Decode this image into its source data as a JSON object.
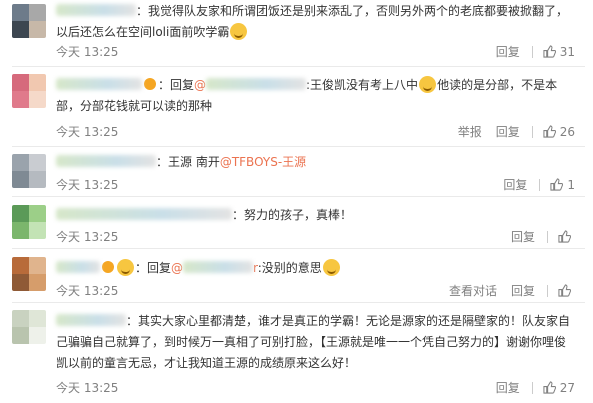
{
  "comments": [
    {
      "text": "：我觉得队友家和所谓团饭还是别来添乱了，否则另外两个的老底都要被掀翻了，以后还怎么在空间loli面前吹学霸",
      "time": "今天 13:25",
      "actions": [
        "回复"
      ],
      "likes": "31",
      "avatar_colors": [
        "#6d7b8a",
        "#a8a8a8",
        "#3c4650",
        "#c7b8a8"
      ]
    },
    {
      "prefix": "：回复",
      "reply_to": "@",
      "text": ":王俊凯没有考上八中",
      "text2": "他读的是分部，不是本部，分部花钱就可以读的那种",
      "time": "今天 13:25",
      "actions": [
        "举报",
        "回复"
      ],
      "likes": "26",
      "avatar_colors": [
        "#d66a7c",
        "#f1c8b0",
        "#e07a8b",
        "#f5d9c9"
      ]
    },
    {
      "text": "：王源 南开",
      "mention": "@TFBOYS-王源",
      "time": "今天 13:25",
      "actions": [
        "回复"
      ],
      "likes": "1",
      "avatar_colors": [
        "#9aa3ac",
        "#c9ccd1",
        "#7f8a94",
        "#b5bac0"
      ]
    },
    {
      "text": "：努力的孩子，真棒！",
      "time": "今天 13:25",
      "actions": [
        "回复"
      ],
      "likes": "",
      "avatar_colors": [
        "#5b9a58",
        "#9ccf88",
        "#7bb66c",
        "#c3e3b5"
      ]
    },
    {
      "prefix": "：回复",
      "reply_to": "@",
      "reply_suffix": "r",
      "text": ":没别的意思",
      "time": "今天 13:25",
      "actions": [
        "查看对话",
        "回复"
      ],
      "likes": "",
      "avatar_colors": [
        "#b86b3a",
        "#e0b48d",
        "#8f5a36",
        "#d69d6b"
      ]
    },
    {
      "text": "：其实大家心里都清楚，谁才是真正的学霸！无论是源家的还是隔壁家的！队友家自己骗骗自己就算了，到时候万一真相了可别打脸，【王源就是唯一一个凭自己努力的】谢谢你哩俊凯以前的童言无忌，才让我知道王源的成绩原来这么好！",
      "time": "今天 13:25",
      "actions": [
        "回复"
      ],
      "likes": "27",
      "avatar_colors": [
        "#c9d2c0",
        "#dfe6d7",
        "#b9c4ae",
        "#eef1ea"
      ]
    }
  ]
}
